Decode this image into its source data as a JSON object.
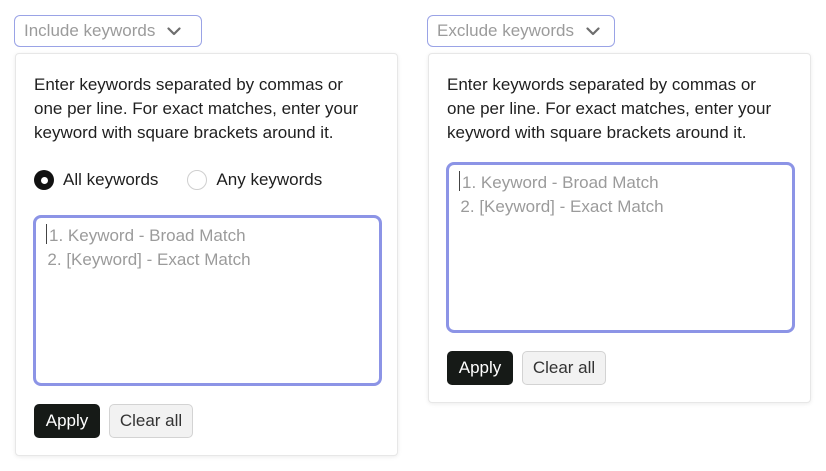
{
  "include": {
    "trigger_label": "Include keywords",
    "help_line1": "Enter keywords separated by commas or",
    "help_line2": "one per line. For exact matches, enter your",
    "help_line3": "keyword with square brackets around it.",
    "radio_all_label": "All keywords",
    "radio_any_label": "Any keywords",
    "selected_radio": "all",
    "placeholder_line1": "1. Keyword - Broad Match",
    "placeholder_line2": "2. [Keyword] - Exact Match",
    "apply_label": "Apply",
    "clear_label": "Clear all"
  },
  "exclude": {
    "trigger_label": "Exclude keywords",
    "help_line1": "Enter keywords separated by commas or",
    "help_line2": "one per line. For exact matches, enter your",
    "help_line3": "keyword with square brackets around it.",
    "placeholder_line1": "1. Keyword - Broad Match",
    "placeholder_line2": "2. [Keyword] - Exact Match",
    "apply_label": "Apply",
    "clear_label": "Clear all"
  },
  "colors": {
    "trigger_border": "#9aa3e6",
    "textarea_focus_border": "#8c94e6",
    "apply_bg": "#161a17"
  },
  "icons": {
    "trigger_chevron": "chevron-down-icon"
  }
}
